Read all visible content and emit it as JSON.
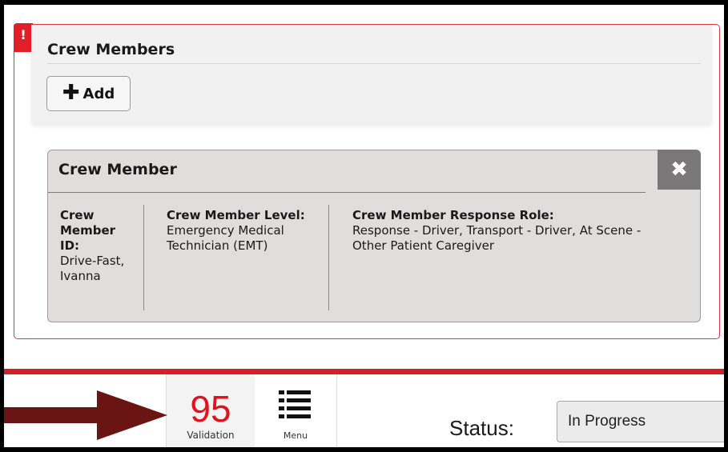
{
  "crew_section": {
    "title": "Crew Members",
    "error_mark": "!",
    "add_label": "Add",
    "add_icon": "plus-icon"
  },
  "crew_member_card": {
    "title": "Crew Member",
    "close_icon": "close-icon",
    "fields": {
      "id": {
        "label": "Crew Member ID:",
        "value": "Drive-Fast, Ivanna"
      },
      "level": {
        "label": "Crew Member Level:",
        "value": "Emergency Medical Technician (EMT)"
      },
      "role": {
        "label": "Crew Member Response Role:",
        "value": "Response - Driver, Transport - Driver, At Scene - Other Patient Caregiver"
      }
    }
  },
  "bottom_bar": {
    "validation": {
      "count": "95",
      "label": "Validation"
    },
    "menu": {
      "label": "Menu",
      "icon": "list-menu-icon"
    },
    "status": {
      "label": "Status:",
      "value": "In Progress"
    }
  },
  "colors": {
    "error_red": "#e11f26",
    "validation_red": "#e0121c",
    "arrow": "#6b1414",
    "card_bg": "#e0dddd"
  }
}
